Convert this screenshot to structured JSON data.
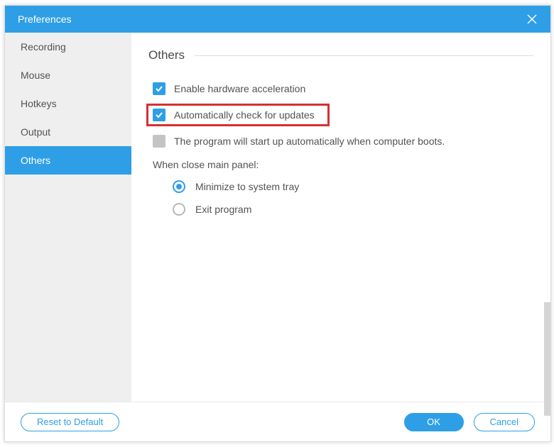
{
  "titlebar": {
    "title": "Preferences"
  },
  "sidebar": {
    "items": [
      {
        "label": "Recording",
        "active": false
      },
      {
        "label": "Mouse",
        "active": false
      },
      {
        "label": "Hotkeys",
        "active": false
      },
      {
        "label": "Output",
        "active": false
      },
      {
        "label": "Others",
        "active": true
      }
    ]
  },
  "content": {
    "section_title": "Others",
    "hw_accel": {
      "label": "Enable hardware acceleration",
      "checked": true
    },
    "auto_update": {
      "label": "Automatically check for updates",
      "checked": true,
      "highlighted": true
    },
    "startup": {
      "label": "The program will start up automatically when computer boots.",
      "checked": false
    },
    "close_panel": {
      "group_label": "When close main panel:",
      "options": [
        {
          "label": "Minimize to system tray",
          "selected": true
        },
        {
          "label": "Exit program",
          "selected": false
        }
      ]
    }
  },
  "footer": {
    "reset": "Reset to Default",
    "ok": "OK",
    "cancel": "Cancel"
  }
}
